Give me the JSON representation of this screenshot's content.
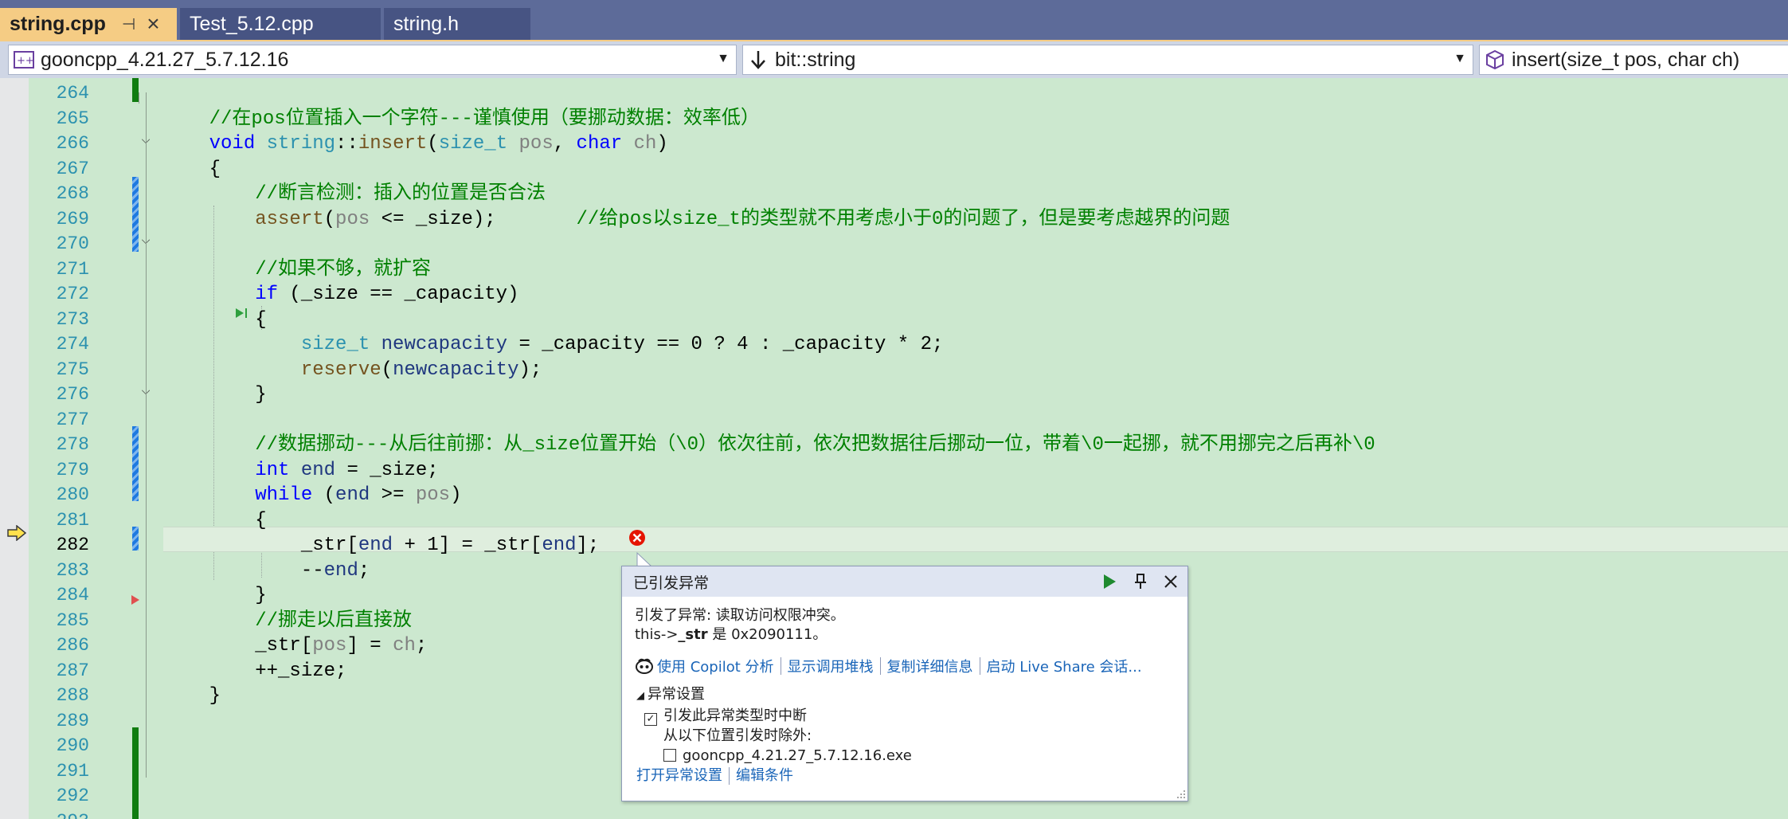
{
  "tabs": [
    {
      "label": "string.cpp",
      "active": true,
      "pin_glyph": "⊣",
      "close_glyph": "×"
    },
    {
      "label": "Test_5.12.cpp",
      "active": false
    },
    {
      "label": "string.h",
      "active": false
    }
  ],
  "navbar": {
    "project": "gooncpp_4.21.27_5.7.12.16",
    "scope": "bit::string",
    "member": "insert(size_t pos, char ch)"
  },
  "line_numbers": [
    "264",
    "265",
    "266",
    "267",
    "268",
    "269",
    "270",
    "271",
    "272",
    "273",
    "274",
    "275",
    "276",
    "277",
    "278",
    "279",
    "280",
    "281",
    "282",
    "283",
    "284",
    "285",
    "286",
    "287",
    "288",
    "289",
    "290",
    "291",
    "292",
    "293"
  ],
  "current_line": "282",
  "code": {
    "c265": "//在pos位置插入一个字符---谨慎使用（要挪动数据：效率低）",
    "c266_void": "void",
    "c266_string": "string",
    "c266_insert": "insert",
    "c266_sizet": "size_t",
    "c266_pos": "pos",
    "c266_char": "char",
    "c266_ch": "ch",
    "c268": "//断言检测：插入的位置是否合法",
    "c269_assert": "assert",
    "c269_pos": "pos",
    "c269_rest": " <= _size);",
    "c269_comment": "//给pos以size_t的类型就不用考虑小于0的问题了，但是要考虑越界的问题",
    "c271": "//如果不够，就扩容",
    "c272_if": "if",
    "c272_rest": " (_size == _capacity)",
    "c274_sizet": "size_t",
    "c274_var": "newcapacity",
    "c274_rest1": " = _capacity == ",
    "c274_n0": "0",
    "c274_rest2": " ? ",
    "c274_n4": "4",
    "c274_rest3": " : _capacity * ",
    "c274_n2": "2",
    "c274_rest4": ";",
    "c275_reserve": "reserve",
    "c275_var": "newcapacity",
    "c278": "//数据挪动---从后往前挪：从_size位置开始（\\0）依次往前，依次把数据往后挪动一位，带着\\0一起挪，就不用挪完之后再补\\0",
    "c279_int": "int",
    "c279_end": "end",
    "c279_rest": " = _size;",
    "c280_while": "while",
    "c280_end": "end",
    "c280_pos": "pos",
    "c282_a": "_str[",
    "c282_end1": "end",
    "c282_b": " + ",
    "c282_n1": "1",
    "c282_c": "] = _str[",
    "c282_end2": "end",
    "c282_d": "];",
    "c283_a": "--",
    "c283_end": "end",
    "c285": "//挪走以后直接放",
    "c286_a": "_str[",
    "c286_pos": "pos",
    "c286_b": "] = ",
    "c286_ch": "ch",
    "c287": "++_size;"
  },
  "exception": {
    "title": "已引发异常",
    "message_line1": "引发了异常: 读取访问权限冲突。",
    "message_line2_prefix": "this->",
    "message_line2_var": "_str",
    "message_line2_suffix": " 是 0x2090111。",
    "links": [
      "使用 Copilot 分析",
      "显示调用堆栈",
      "复制详细信息",
      "启动 Live Share 会话..."
    ],
    "settings_header": "异常设置",
    "break_when_thrown": "引发此异常类型时中断",
    "break_checked": true,
    "except_when_from": "从以下位置引发时除外:",
    "module": "gooncpp_4.21.27_5.7.12.16.exe",
    "module_checked": false,
    "footer_links": [
      "打开异常设置",
      "编辑条件"
    ]
  },
  "colors": {
    "editor_bg": "#cce8cf",
    "keyword": "#0000ff",
    "type": "#2b91af",
    "comment": "#008000",
    "error": "#e51400",
    "active_tab": "#f5cc84"
  },
  "icons": {
    "project_icon": "project-icon",
    "scope_icon": "down-arrow-icon",
    "member_icon": "method-cube-icon",
    "error_icon": "error-circle-icon",
    "instruction_pointer": "yellow-arrow-icon"
  }
}
